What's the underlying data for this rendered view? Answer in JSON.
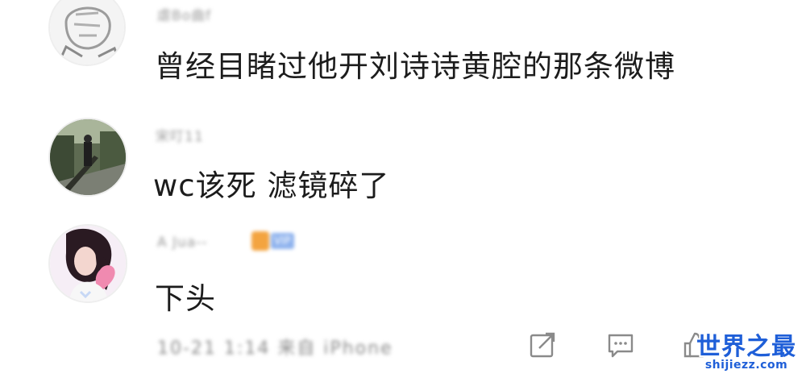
{
  "comments": [
    {
      "username": "虐Bo曲f",
      "text": "曾经目睹过他开刘诗诗黄腔的那条微博",
      "avatar": "sketch-avatar"
    },
    {
      "username": "宋叮11",
      "text": "wc该死 滤镜碎了",
      "avatar": "bridge-photo-avatar"
    },
    {
      "username": "A Jua--",
      "text": "下头",
      "avatar": "illustrated-girl-avatar",
      "badge": "VIP"
    }
  ],
  "footer": {
    "meta": "10-21 1:14 来自 iPhone",
    "icons": [
      "share-icon",
      "comment-icon",
      "like-icon"
    ]
  },
  "watermark": {
    "title": "世界之最",
    "url": "shijiezz.com"
  },
  "colors": {
    "text": "#1c1c1c",
    "muted": "#9a9a9a",
    "watermark": "#1f5fd8"
  }
}
